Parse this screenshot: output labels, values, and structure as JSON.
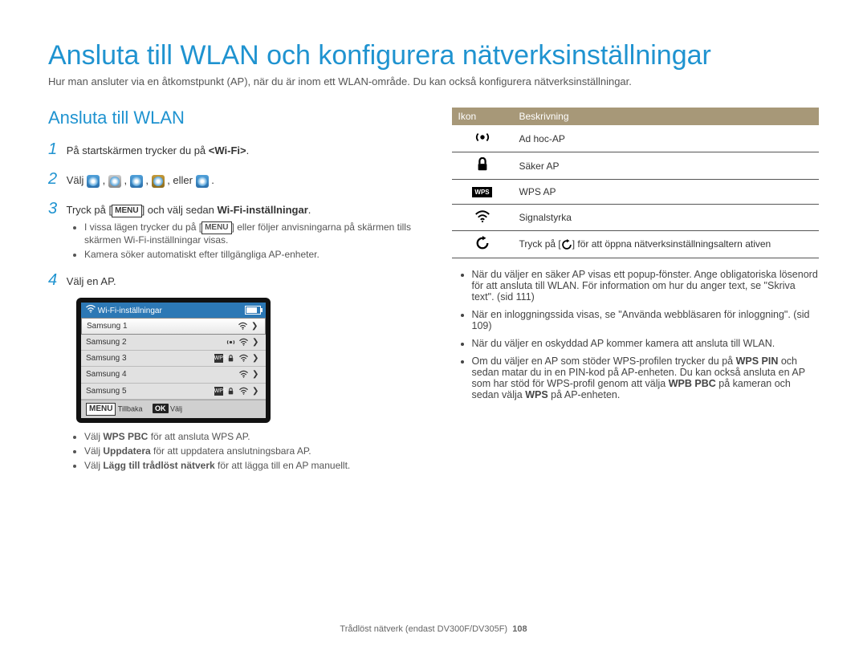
{
  "title": "Ansluta till WLAN och konfigurera nätverksinställningar",
  "intro": "Hur man ansluter via en åtkomstpunkt (AP), när du är inom ett WLAN-område. Du kan också konfigurera nätverksinställningar.",
  "section_heading": "Ansluta till WLAN",
  "steps": {
    "s1_pre": "På startskärmen trycker du på ",
    "s1_bold": "<Wi-Fi>",
    "s1_post": ".",
    "s2_pre": "Välj ",
    "s2_post": ", eller ",
    "s2_end": ".",
    "s3_pre": "Tryck på [",
    "s3_menu": "MENU",
    "s3_mid": "] och välj sedan ",
    "s3_bold": "Wi-Fi-inställningar",
    "s3_post": ".",
    "s3_sub1_pre": "I vissa lägen trycker du på [",
    "s3_sub1_menu": "MENU",
    "s3_sub1_post": "] eller följer anvisningarna på skärmen tills skärmen Wi-Fi-inställningar visas.",
    "s3_sub2": "Kamera söker automatiskt efter tillgängliga AP-enheter.",
    "s4": "Välj en AP.",
    "s4_sub1_pre": "Välj ",
    "s4_sub1_bold": "WPS PBC",
    "s4_sub1_post": " för att ansluta WPS AP.",
    "s4_sub2_pre": "Välj ",
    "s4_sub2_bold": "Uppdatera",
    "s4_sub2_post": " för att uppdatera anslutningsbara AP.",
    "s4_sub3_pre": "Välj ",
    "s4_sub3_bold": "Lägg till trådlöst nätverk",
    "s4_sub3_post": " för att lägga till en AP manuellt."
  },
  "wifi_panel": {
    "title": "Wi-Fi-inställningar",
    "rows": [
      "Samsung 1",
      "Samsung 2",
      "Samsung 3",
      "Samsung 4",
      "Samsung 5"
    ],
    "back_btn": "MENU",
    "back_label": "Tillbaka",
    "ok_btn": "OK",
    "ok_label": "Välj"
  },
  "icon_table": {
    "h1": "Ikon",
    "h2": "Beskrivning",
    "r1": "Ad hoc-AP",
    "r2": "Säker AP",
    "r3": "WPS AP",
    "r4": "Signalstyrka",
    "r5_pre": "Tryck på [",
    "r5_post": "] för att öppna nätverksinställningsaltern ativen"
  },
  "right_bullets": {
    "b1": "När du väljer en säker AP visas ett popup-fönster. Ange obligatoriska lösenord för att ansluta till WLAN. För information om hur du anger text, se \"Skriva text\". (sid 111)",
    "b2": "När en inloggningssida visas, se \"Använda webbläsaren för inloggning\". (sid 109)",
    "b3": "När du väljer en oskyddad AP kommer kamera att ansluta till WLAN.",
    "b4_pre": "Om du väljer en AP som stöder WPS-profilen trycker du på ",
    "b4_b1": "WPS PIN",
    "b4_mid1": " och sedan matar du in en PIN-kod på AP-enheten. Du kan också ansluta en AP som har stöd för WPS-profil genom att välja ",
    "b4_b2": "WPB PBC",
    "b4_mid2": " på kameran och sedan välja ",
    "b4_b3": "WPS",
    "b4_post": " på AP-enheten."
  },
  "footer_pre": "Trådlöst nätverk (endast DV300F/DV305F)",
  "footer_page": "108"
}
